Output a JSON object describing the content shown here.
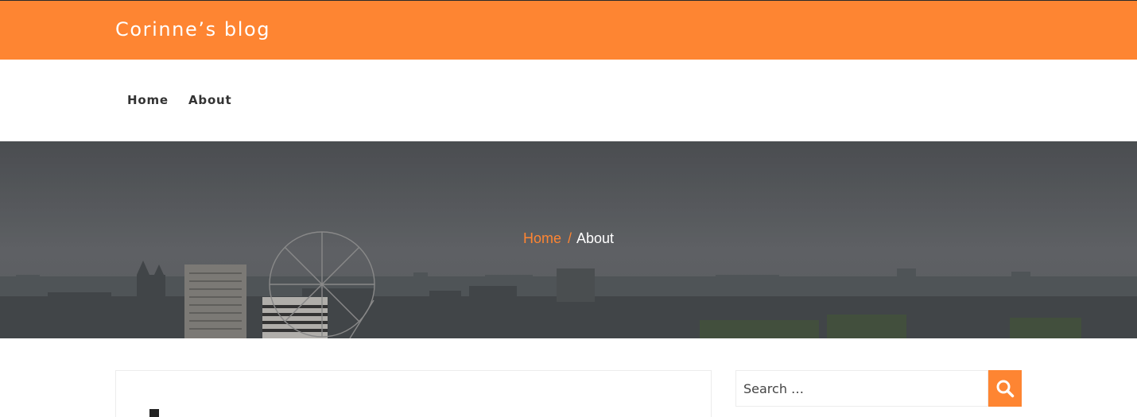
{
  "header": {
    "site_title": "Corinne’s blog",
    "brand_color": "#fe8532"
  },
  "nav": {
    "items": [
      {
        "label": "Home"
      },
      {
        "label": "About"
      }
    ]
  },
  "hero": {
    "image": "london-skyline-photo",
    "breadcrumb": {
      "home_label": "Home",
      "separator": "/",
      "current_label": "About"
    }
  },
  "sidebar": {
    "search": {
      "placeholder": "Search …",
      "button_icon": "search-icon"
    }
  }
}
